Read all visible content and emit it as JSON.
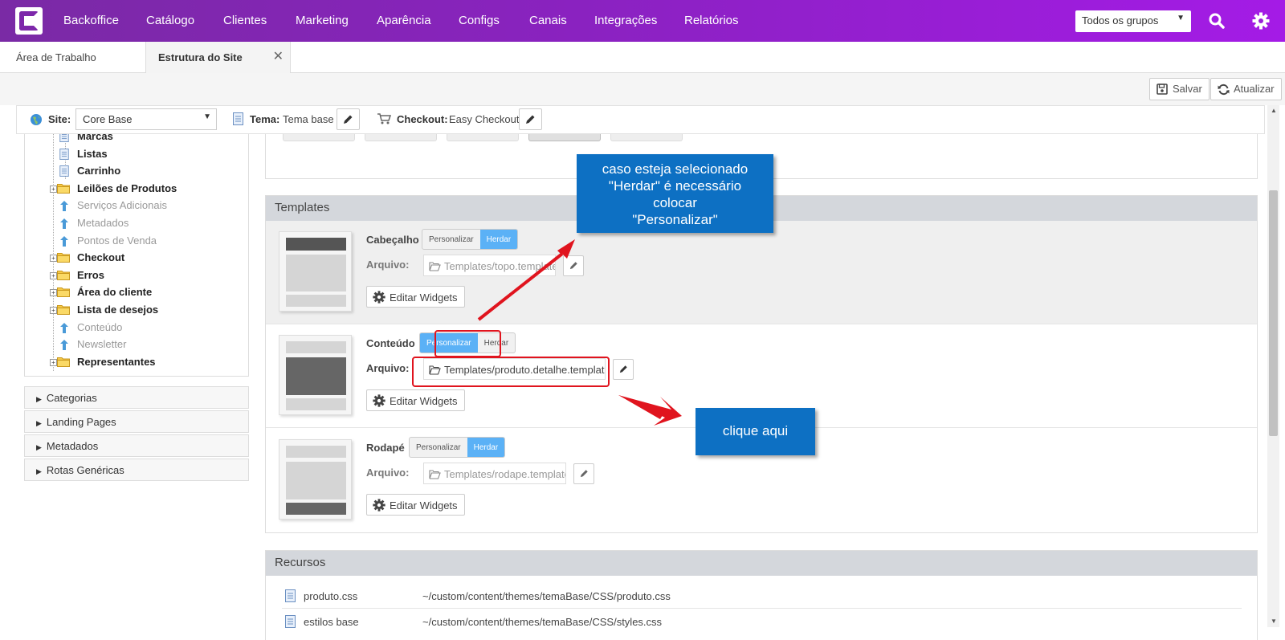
{
  "nav": {
    "items": [
      "Backoffice",
      "Catálogo",
      "Clientes",
      "Marketing",
      "Aparência",
      "Configs",
      "Canais",
      "Integrações",
      "Relatórios"
    ],
    "group_select": "Todos os grupos"
  },
  "tabs": {
    "first": "Área de Trabalho",
    "active": "Estrutura do Site"
  },
  "toolbar": {
    "save": "Salvar",
    "refresh": "Atualizar"
  },
  "sitebar": {
    "site_label": "Site:",
    "site_value": "Core Base",
    "theme_label": "Tema:",
    "theme_value": "Tema base",
    "checkout_label": "Checkout:",
    "checkout_value": "Easy Checkout"
  },
  "tree": [
    {
      "label": "Marcas",
      "style": "bold",
      "icon": "page-icon"
    },
    {
      "label": "Listas",
      "style": "bold",
      "icon": "page-icon"
    },
    {
      "label": "Carrinho",
      "style": "bold",
      "icon": "page-icon"
    },
    {
      "label": "Leilões de Produtos",
      "style": "bold",
      "icon": "folder-icon"
    },
    {
      "label": "Serviços Adicionais",
      "style": "dim",
      "icon": "inherit-arrow-icon"
    },
    {
      "label": "Metadados",
      "style": "dim",
      "icon": "inherit-arrow-icon"
    },
    {
      "label": "Pontos de Venda",
      "style": "dim",
      "icon": "inherit-arrow-icon"
    },
    {
      "label": "Checkout",
      "style": "bold",
      "icon": "folder-icon"
    },
    {
      "label": "Erros",
      "style": "bold",
      "icon": "folder-icon"
    },
    {
      "label": "Área do cliente",
      "style": "bold",
      "icon": "folder-icon"
    },
    {
      "label": "Lista de desejos",
      "style": "bold",
      "icon": "folder-icon"
    },
    {
      "label": "Conteúdo",
      "style": "dim",
      "icon": "inherit-arrow-icon"
    },
    {
      "label": "Newsletter",
      "style": "dim",
      "icon": "inherit-arrow-icon"
    },
    {
      "label": "Representantes",
      "style": "bold",
      "icon": "folder-icon"
    }
  ],
  "accordion": [
    "Categorias",
    "Landing Pages",
    "Metadados",
    "Rotas Genéricas"
  ],
  "templates": {
    "title": "Templates",
    "file_label": "Arquivo:",
    "personalize": "Personalizar",
    "inherit": "Herdar",
    "edit_widgets": "Editar Widgets",
    "rows": [
      {
        "label": "Cabeçalho",
        "file": "Templates/topo.template",
        "mode": "Herdar"
      },
      {
        "label": "Conteúdo",
        "file": "Templates/produto.detalhe.template",
        "mode": "Personalizar"
      },
      {
        "label": "Rodapé",
        "file": "Templates/rodape.template",
        "mode": "Herdar"
      }
    ]
  },
  "resources": {
    "title": "Recursos",
    "rows": [
      {
        "name": "produto.css",
        "path": "~/custom/content/themes/temaBase/CSS/produto.css"
      },
      {
        "name": "estilos base",
        "path": "~/custom/content/themes/temaBase/CSS/styles.css"
      }
    ]
  },
  "annotations": {
    "callout1": [
      "caso esteja selecionado",
      "\"Herdar\" é necessário",
      "colocar",
      "\"Personalizar\""
    ],
    "callout2": "clique aqui"
  },
  "colors": {
    "nav_start": "#7a2aa5",
    "nav_end": "#a41be6",
    "toggle_on": "#5bb1f6",
    "callout": "#0d70c3",
    "highlight": "#e0141e"
  }
}
